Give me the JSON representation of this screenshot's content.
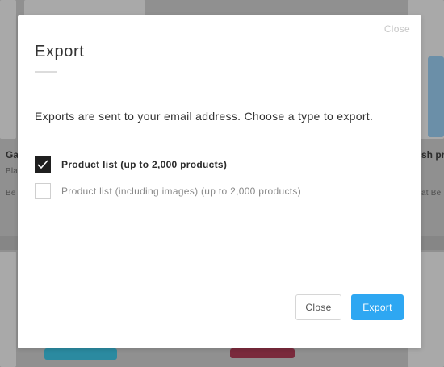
{
  "background": {
    "left_card": {
      "title_fragment": "Ga",
      "subtitle_fragment": "Bla",
      "meta_fragment": "Be"
    },
    "right_card": {
      "title_fragment": "sh pr",
      "meta_fragment": "at Be"
    }
  },
  "modal": {
    "top_close_label": "Close",
    "title": "Export",
    "description": "Exports are sent to your email address. Choose a type to export.",
    "options": [
      {
        "label": "Product list (up to 2,000 products)",
        "checked": true
      },
      {
        "label": "Product list (including images) (up to 2,000 products)",
        "checked": false
      }
    ],
    "buttons": {
      "close_label": "Close",
      "export_label": "Export"
    }
  },
  "colors": {
    "accent": "#2ea7f2",
    "checkbox_checked": "#1f1f1f",
    "overlay": "#909090"
  },
  "icons": {
    "checked": "check-icon"
  }
}
